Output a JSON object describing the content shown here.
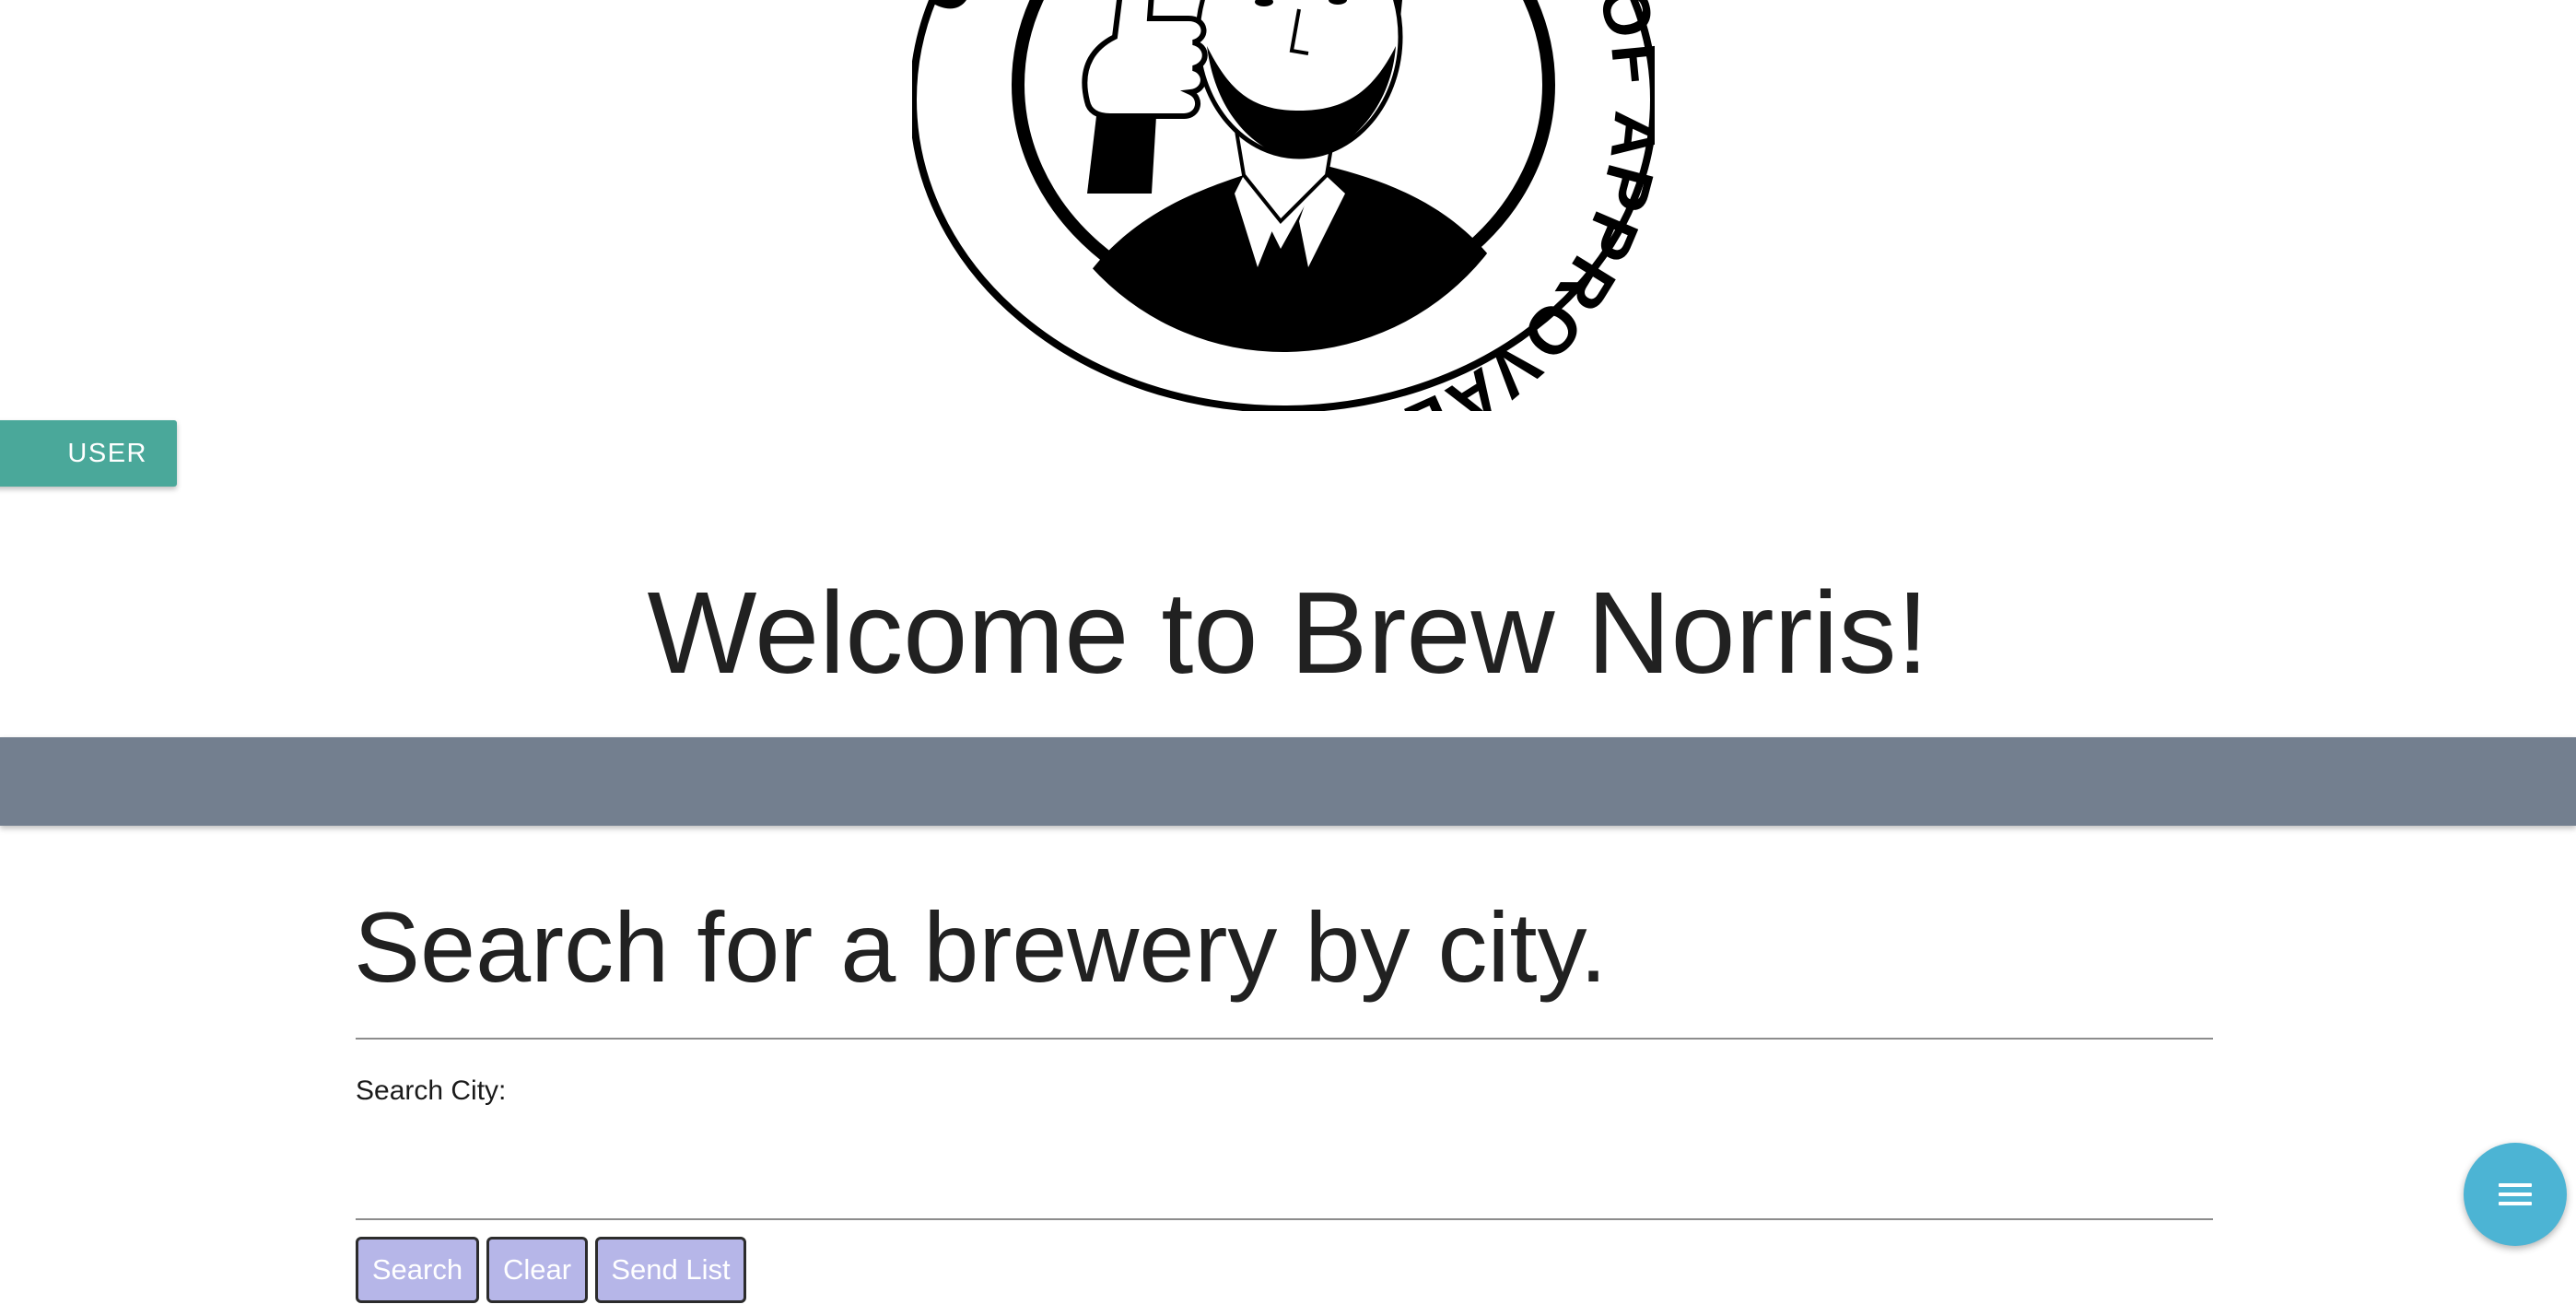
{
  "logo": {
    "ring_text": "CHUCK NORRIS STAMP OF APPROVAL",
    "icon": "thumbs-up-portrait-stamp-icon"
  },
  "user_guide": {
    "label": "USER GUIDE"
  },
  "welcome": {
    "title": "Welcome to Brew Norris!"
  },
  "search": {
    "heading": "Search for a brewery by city.",
    "city_label": "Search City:",
    "city_value": "",
    "buttons": {
      "search": "Search",
      "clear": "Clear",
      "send_list": "Send List"
    }
  },
  "fab": {
    "icon": "menu-icon"
  },
  "colors": {
    "user_guide_bg": "#4aa89a",
    "band": "#737f8f",
    "button_bg": "#b6b6e8",
    "fab_bg": "#4cb4d4"
  }
}
